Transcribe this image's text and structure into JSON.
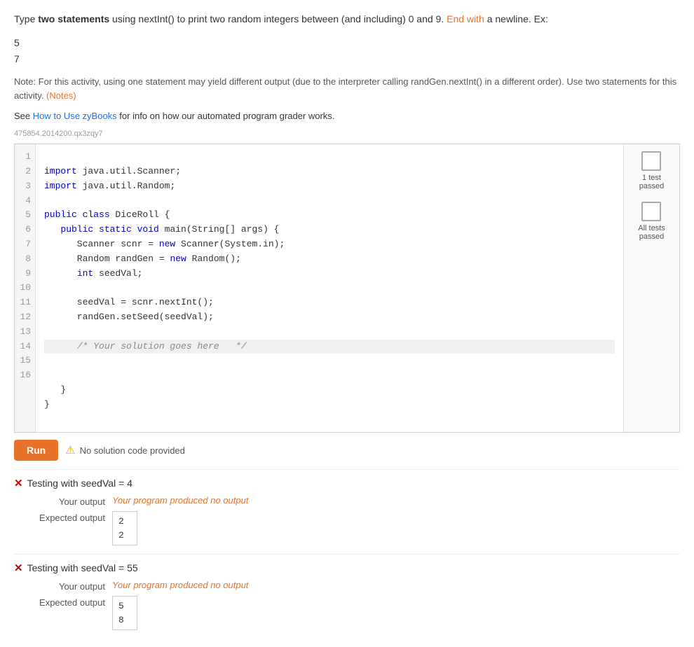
{
  "page": {
    "instructions": {
      "prefix": "Type ",
      "bold": "two statements",
      "middle": " using nextInt() to print two random integers between (and including) 0 and 9. ",
      "end_highlight": "End with",
      "end_rest": " a newline. Ex:"
    },
    "example_output": [
      "5",
      "7"
    ],
    "note": "Note: For this activity, using one statement may yield different output (due to the interpreter calling randGen.nextInt() in a different order). Use two statements for this activity.",
    "note_link_text": "(Notes)",
    "note_link": "#",
    "see_text": "See ",
    "see_link_text": "How to Use zyBooks",
    "see_rest": " for info on how our automated program grader works.",
    "activity_id": "475854.2014200.qx3zqy7",
    "code_lines": [
      {
        "num": 1,
        "text": "import java.util.Scanner;",
        "highlighted": false
      },
      {
        "num": 2,
        "text": "import java.util.Random;",
        "highlighted": false
      },
      {
        "num": 3,
        "text": "",
        "highlighted": false
      },
      {
        "num": 4,
        "text": "public class DiceRoll {",
        "highlighted": false
      },
      {
        "num": 5,
        "text": "   public static void main(String[] args) {",
        "highlighted": false
      },
      {
        "num": 6,
        "text": "      Scanner scnr = new Scanner(System.in);",
        "highlighted": false
      },
      {
        "num": 7,
        "text": "      Random randGen = new Random();",
        "highlighted": false
      },
      {
        "num": 8,
        "text": "      int seedVal;",
        "highlighted": false
      },
      {
        "num": 9,
        "text": "",
        "highlighted": false
      },
      {
        "num": 10,
        "text": "      seedVal = scnr.nextInt();",
        "highlighted": false
      },
      {
        "num": 11,
        "text": "      randGen.setSeed(seedVal);",
        "highlighted": false
      },
      {
        "num": 12,
        "text": "",
        "highlighted": false
      },
      {
        "num": 13,
        "text": "      /* Your solution goes here   */",
        "highlighted": true
      },
      {
        "num": 14,
        "text": "",
        "highlighted": false
      },
      {
        "num": 15,
        "text": "   }",
        "highlighted": false
      },
      {
        "num": 16,
        "text": "}",
        "highlighted": false
      }
    ],
    "side_panel": {
      "badge1_label": "1 test\npassed",
      "badge2_label": "All tests\npassed"
    },
    "run_button": "Run",
    "warning_text": "No solution code provided",
    "tests": [
      {
        "id": "test1",
        "title": "Testing with seedVal = 4",
        "your_output_label": "Your output",
        "your_output_value": "Your program produced no output",
        "expected_output_label": "Expected output",
        "expected_lines": [
          "2",
          "2"
        ]
      },
      {
        "id": "test2",
        "title": "Testing with seedVal = 55",
        "your_output_label": "Your output",
        "your_output_value": "Your program produced no output",
        "expected_output_label": "Expected output",
        "expected_lines": [
          "5",
          "8"
        ]
      }
    ]
  }
}
